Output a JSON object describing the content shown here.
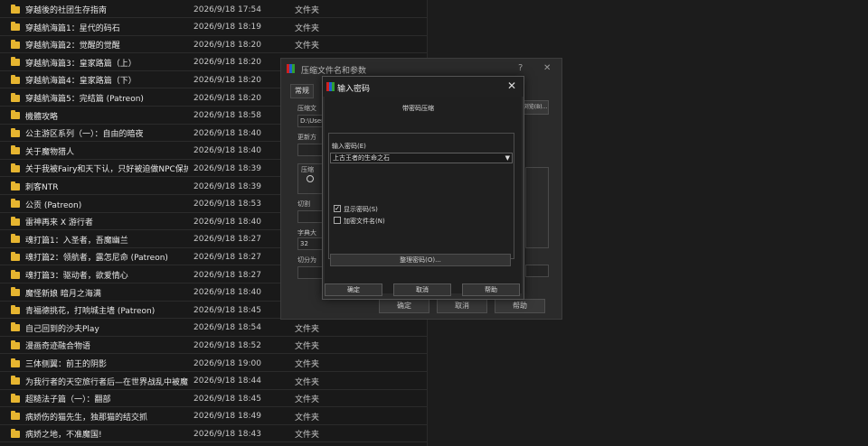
{
  "files": [
    {
      "name": "穿越後的社团生存指南",
      "date": "2026/9/18 17:54",
      "type": "文件夹"
    },
    {
      "name": "穿越航海篇1：星代的码石",
      "date": "2026/9/18 18:19",
      "type": "文件夹"
    },
    {
      "name": "穿越航海篇2：觉醒的觉醒",
      "date": "2026/9/18 18:20",
      "type": "文件夹"
    },
    {
      "name": "穿越航海篇3：皇家路篇（上）",
      "date": "2026/9/18 18:20",
      "type": "文件夹"
    },
    {
      "name": "穿越航海篇4：皇家路篇（下）",
      "date": "2026/9/18 18:20",
      "type": "文件夹"
    },
    {
      "name": "穿越航海篇5：完结篇 (Patreon)",
      "date": "2026/9/18 18:20",
      "type": "文件夹"
    },
    {
      "name": "機體攻略",
      "date": "2026/9/18 18:58",
      "type": "文件夹"
    },
    {
      "name": "公主游区系列（一）：自由的暗夜",
      "date": "2026/9/18 18:40",
      "type": "文件夹"
    },
    {
      "name": "关于魔物猎人",
      "date": "2026/9/18 18:40",
      "type": "文件夹"
    },
    {
      "name": "关于我被Fairy和天下认，只好被迫做NPC保护...",
      "date": "2026/9/18 18:39",
      "type": "文件夹"
    },
    {
      "name": "刺客NTR",
      "date": "2026/9/18 18:39",
      "type": "文件夹"
    },
    {
      "name": "公贡 (Patreon)",
      "date": "2026/9/18 18:53",
      "type": "文件夹"
    },
    {
      "name": "雷神再来 X 游行者",
      "date": "2026/9/18 18:40",
      "type": "文件夹"
    },
    {
      "name": "魂打篇1：入圣者，吾魔幽兰",
      "date": "2026/9/18 18:27",
      "type": "文件夹"
    },
    {
      "name": "魂打篇2：领航者，露怎尼命 (Patreon)",
      "date": "2026/9/18 18:27",
      "type": "文件夹"
    },
    {
      "name": "魂打篇3：驱动者，欲爱情心",
      "date": "2026/9/18 18:27",
      "type": "文件夹"
    },
    {
      "name": "魔怪新娘 暗月之海满",
      "date": "2026/9/18 18:40",
      "type": "文件夹"
    },
    {
      "name": "青福德挑花，打响城主墙 (Patreon)",
      "date": "2026/9/18 18:45",
      "type": "文件夹"
    },
    {
      "name": "自己回到的沙夫Play",
      "date": "2026/9/18 18:54",
      "type": "文件夹"
    },
    {
      "name": "漫画奇迹融合物语",
      "date": "2026/9/18 18:52",
      "type": "文件夹"
    },
    {
      "name": "三体侧翼：前王的阴影",
      "date": "2026/9/18 19:00",
      "type": "文件夹"
    },
    {
      "name": "为我行者的天空旅行者后—在世界战乱中被魔...",
      "date": "2026/9/18 18:44",
      "type": "文件夹"
    },
    {
      "name": "超糙法子篇（一）：翻部",
      "date": "2026/9/18 18:45",
      "type": "文件夹"
    },
    {
      "name": "病娇伤的猫先生，独那猫的结交抓",
      "date": "2026/9/18 18:49",
      "type": "文件夹"
    },
    {
      "name": "病娇之地，不准魔国!",
      "date": "2026/9/18 18:43",
      "type": "文件夹"
    }
  ],
  "archive_dialog": {
    "title": "压缩文件名和参数",
    "help": "?",
    "close": "✕",
    "tab_general": "常规",
    "btn_browse": "浏览(B)...",
    "field_path": "D:\\User",
    "field_method": "32",
    "label_a": "压缩文",
    "label_b": "更新方",
    "label_c": "压缩",
    "label_d": "切割",
    "label_e": "字典大",
    "label_f": "切分为",
    "btn_ok": "确定",
    "btn_cancel": "取消",
    "btn_help": "帮助"
  },
  "password_dialog": {
    "title": "输入密码",
    "close": "✕",
    "header": "带密码压缩",
    "label_password": "输入密码(E)",
    "password_value": "上古王者的生命之石",
    "show_password": "显示密码(S)",
    "show_password_checked": "✓",
    "encrypt_names": "加密文件名(N)",
    "btn_organize": "整理密码(O)...",
    "btn_ok": "确定",
    "btn_cancel": "取消",
    "btn_help": "帮助"
  },
  "colors": {
    "folder": "#e6b530",
    "accent_red": "#d02020",
    "accent_blue": "#2060d0"
  }
}
